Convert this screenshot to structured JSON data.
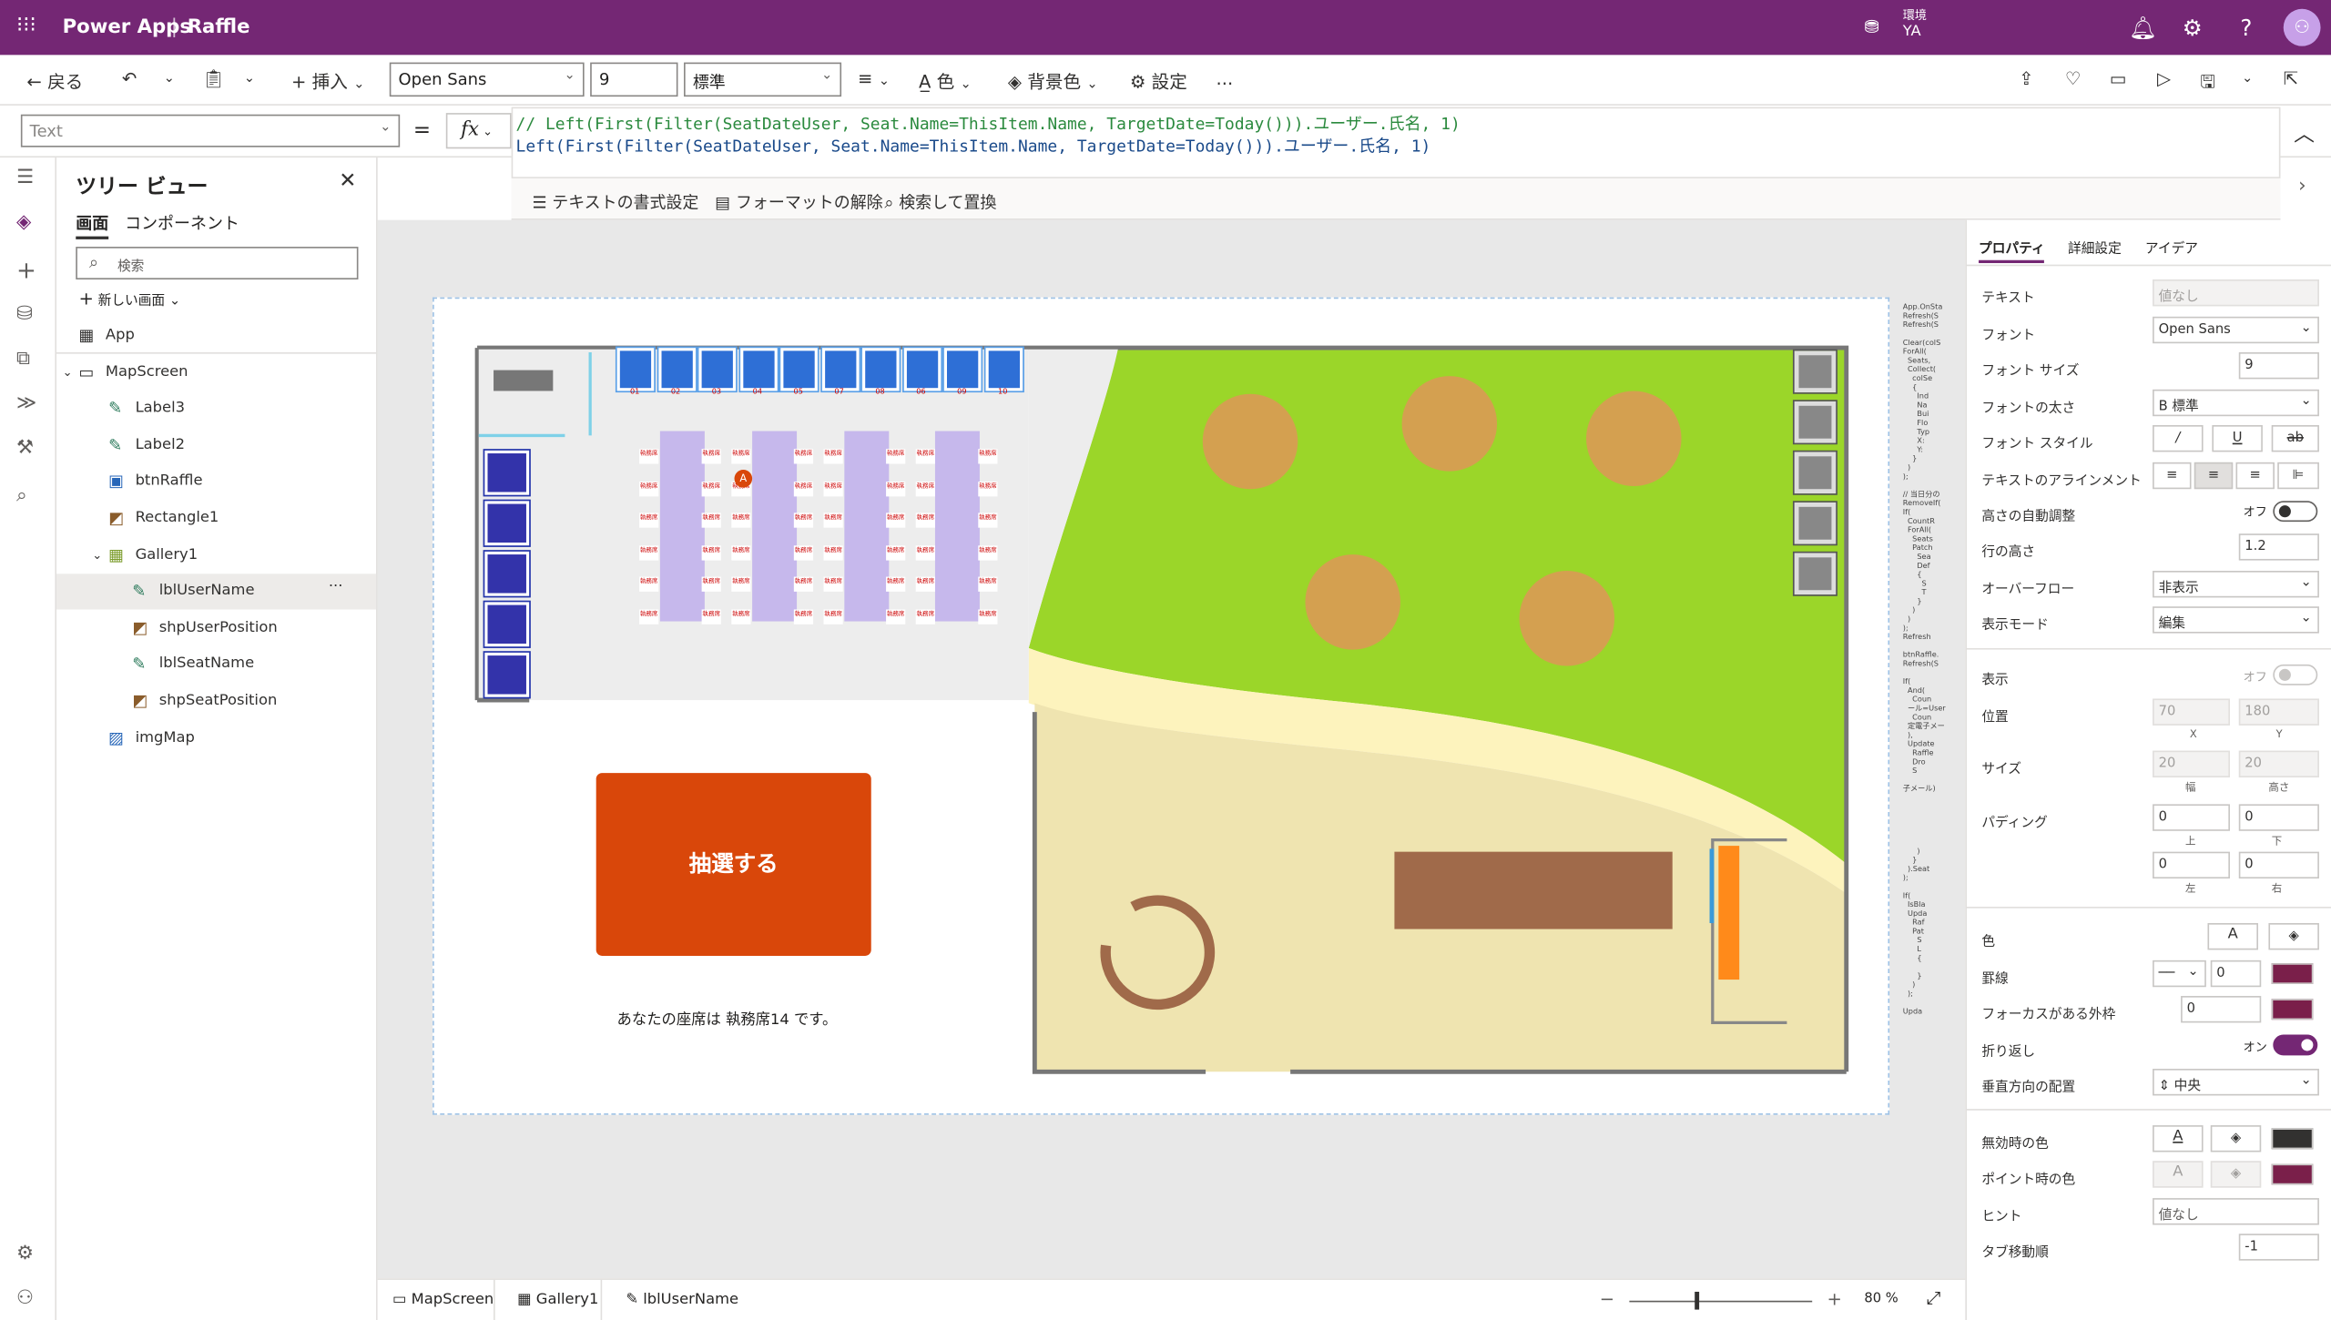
{
  "header": {
    "app_name": "Power Apps",
    "app_title": "Raffle",
    "env_label": "環境",
    "user_initials": "YA"
  },
  "toolbar": {
    "back": "戻る",
    "insert": "挿入",
    "font": "Open Sans",
    "font_size": "9",
    "font_weight": "標準",
    "color": "色",
    "fill": "背景色",
    "settings": "設定",
    "more": "..."
  },
  "formula": {
    "property": "Text",
    "eq": "=",
    "fx": "fx",
    "line1": "// Left(First(Filter(SeatDateUser, Seat.Name=ThisItem.Name, TargetDate=Today())).ユーザー.氏名, 1)",
    "line2": "Left(First(Filter(SeatDateUser, Seat.Name=ThisItem.Name, TargetDate=Today())).ユーザー.氏名, 1)",
    "format_text": "テキストの書式設定",
    "remove_format": "フォーマットの解除",
    "find_replace": "検索して置換"
  },
  "tree": {
    "title": "ツリー ビュー",
    "tab_screens": "画面",
    "tab_components": "コンポーネント",
    "search_placeholder": "検索",
    "new_screen": "新しい画面",
    "items": [
      {
        "label": "App",
        "indent": 0,
        "icon": "app-icon"
      },
      {
        "label": "MapScreen",
        "indent": 0,
        "icon": "screen-icon"
      },
      {
        "label": "Label3",
        "indent": 1,
        "icon": "label-icon"
      },
      {
        "label": "Label2",
        "indent": 1,
        "icon": "label-icon"
      },
      {
        "label": "btnRaffle",
        "indent": 1,
        "icon": "button-icon"
      },
      {
        "label": "Rectangle1",
        "indent": 1,
        "icon": "shape-icon"
      },
      {
        "label": "Gallery1",
        "indent": 1,
        "icon": "gallery-icon"
      },
      {
        "label": "lblUserName",
        "indent": 2,
        "icon": "label-icon"
      },
      {
        "label": "shpUserPosition",
        "indent": 2,
        "icon": "shape-icon"
      },
      {
        "label": "lblSeatName",
        "indent": 2,
        "icon": "label-icon"
      },
      {
        "label": "shpSeatPosition",
        "indent": 2,
        "icon": "shape-icon"
      },
      {
        "label": "imgMap",
        "indent": 1,
        "icon": "image-icon"
      }
    ],
    "selected_more": "···"
  },
  "canvas": {
    "raffle_button": "抽選する",
    "result_text": "あなたの座席は 執務席14 です。",
    "avatar_letter": "A",
    "seat_label": "執務席",
    "top_desk_numbers": [
      "01",
      "02",
      "03",
      "04",
      "05",
      "07",
      "08",
      "06",
      "09",
      "10"
    ],
    "side_notes": "App.OnSta\nRefresh(S\nRefresh(S\n\nClear(colS\nForAll(\n  Seats,\n  Collect(\n    colSe\n    {\n      Ind\n      Na\n      Bui\n      Flo\n      Typ\n      X:\n      Y:\n    }\n  )\n);\n\n// 当日分の\nRemoveIf(\nIf(\n  CountR\n  ForAll(\n    Seats\n    Patch\n      Sea\n      Def\n      {\n        S\n        T\n      }\n    )\n  )\n);\nRefresh\n\nbtnRaffle.\nRefresh(S\n\nIf(\n  And(\n    Coun\n  ール=User\n    Coun\n  定電子メー\n  ),\n  Update\n    Raffle\n    Dro\n    S\n\n子メール)\n\n\n\n\n\n\n      )\n    }\n  ).Seat\n);\n\nIf(\n  IsBla\n  Upda\n    Raf\n    Pat\n      S\n      L\n      {\n\n      }\n    )\n  );\n\nUpda"
  },
  "statusbar": {
    "screen": "MapScreen",
    "gallery": "Gallery1",
    "label": "lblUserName",
    "zoom": "80",
    "zoom_unit": "%",
    "zoom_level": 80
  },
  "props": {
    "tabs": [
      "プロパティ",
      "詳細設定",
      "アイデア"
    ],
    "text_label": "テキスト",
    "text_value": "値なし",
    "font_label": "フォント",
    "font_value": "Open Sans",
    "font_size_label": "フォント サイズ",
    "font_size_value": "9",
    "font_weight_label": "フォントの太さ",
    "font_weight_value": "B  標準",
    "font_style_label": "フォント スタイル",
    "align_label": "テキストのアラインメント",
    "autoheight_label": "高さの自動調整",
    "autoheight_value": "オフ",
    "lineheight_label": "行の高さ",
    "lineheight_value": "1.2",
    "overflow_label": "オーバーフロー",
    "overflow_value": "非表示",
    "displaymode_label": "表示モード",
    "displaymode_value": "編集",
    "visible_label": "表示",
    "visible_value": "オフ",
    "position_label": "位置",
    "pos_x": "70",
    "pos_y": "180",
    "x_sub": "X",
    "y_sub": "Y",
    "size_label": "サイズ",
    "size_w": "20",
    "size_h": "20",
    "w_sub": "幅",
    "h_sub": "高さ",
    "padding_label": "パディング",
    "pad_top": "0",
    "pad_bottom": "0",
    "pad_left": "0",
    "pad_right": "0",
    "top_sub": "上",
    "bottom_sub": "下",
    "left_sub": "左",
    "right_sub": "右",
    "color_label": "色",
    "color_a": "A",
    "border_label": "罫線",
    "border_value": "0",
    "focus_label": "フォーカスがある外枠",
    "focus_value": "0",
    "wrap_label": "折り返し",
    "wrap_value": "オン",
    "valign_label": "垂直方向の配置",
    "valign_value": "中央",
    "disabled_color_label": "無効時の色",
    "hover_color_label": "ポイント時の色",
    "hint_label": "ヒント",
    "hint_value": "値なし",
    "tab_label": "タブ移動順",
    "tab_value": "-1",
    "colors": {
      "accent": "#742774",
      "swatch": "#7a1f4a",
      "dark": "#323130"
    }
  }
}
